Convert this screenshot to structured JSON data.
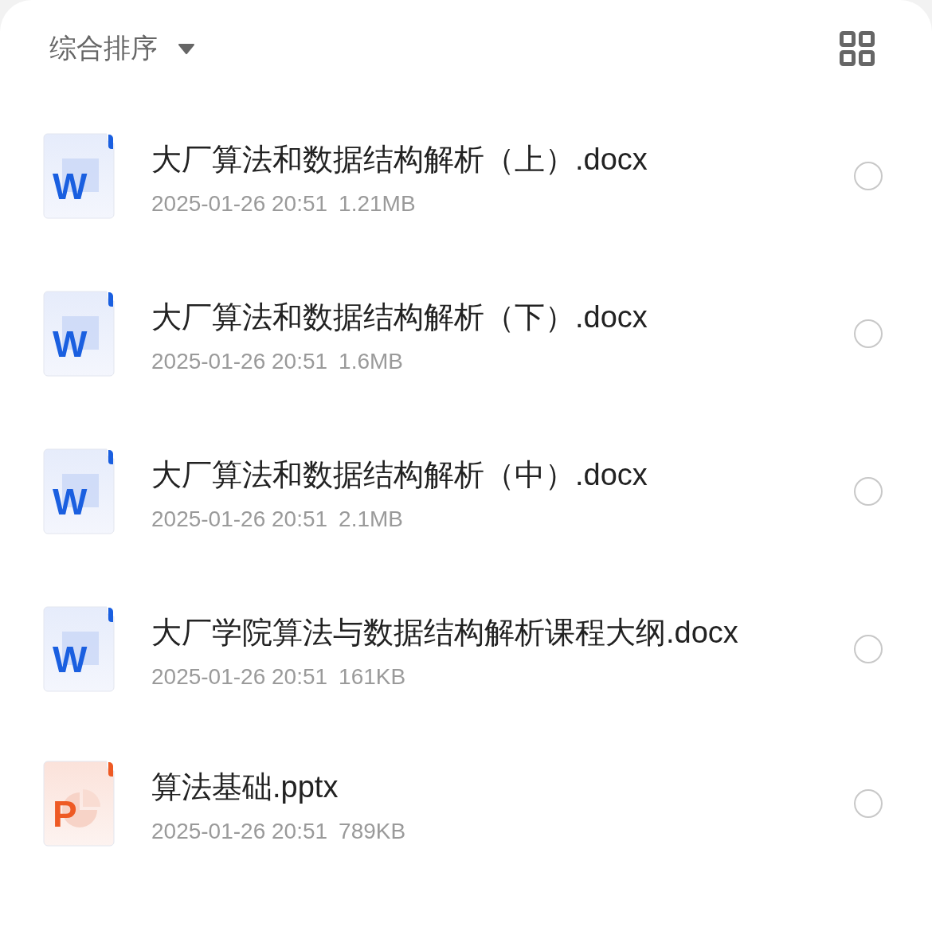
{
  "toolbar": {
    "sort_label": "综合排序"
  },
  "files": [
    {
      "kind": "word",
      "badge": "W",
      "name": "大厂算法和数据结构解析（上）.docx",
      "date": "2025-01-26 20:51",
      "size": "1.21MB",
      "selected": false
    },
    {
      "kind": "word",
      "badge": "W",
      "name": "大厂算法和数据结构解析（下）.docx",
      "date": "2025-01-26 20:51",
      "size": "1.6MB",
      "selected": false
    },
    {
      "kind": "word",
      "badge": "W",
      "name": "大厂算法和数据结构解析（中）.docx",
      "date": "2025-01-26 20:51",
      "size": "2.1MB",
      "selected": false
    },
    {
      "kind": "word",
      "badge": "W",
      "name": "大厂学院算法与数据结构解析课程大纲.docx",
      "date": "2025-01-26 20:51",
      "size": "161KB",
      "selected": false
    },
    {
      "kind": "ppt",
      "badge": "P",
      "name": "算法基础.pptx",
      "date": "2025-01-26 20:51",
      "size": "789KB",
      "selected": false
    }
  ]
}
